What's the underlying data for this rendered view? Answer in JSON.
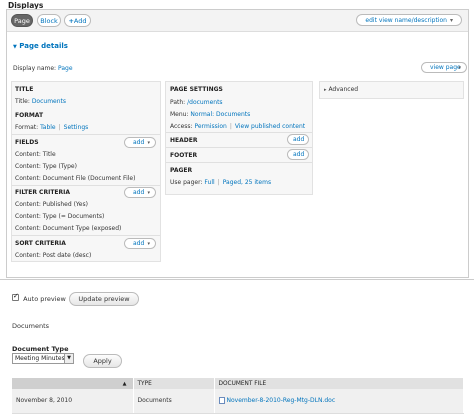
{
  "header": {
    "title": "Displays"
  },
  "tabs": [
    {
      "label": "Page",
      "active": true
    },
    {
      "label": "Block",
      "active": false
    },
    {
      "label": "Add",
      "active": false
    }
  ],
  "edit_view_label": "edit view name/description",
  "page_details": {
    "heading": "Page details",
    "display_name_label": "Display name:",
    "display_name_value": "Page",
    "view_page_label": "view page"
  },
  "left_col": {
    "title_head": "Title",
    "title_label": "Title:",
    "title_value": "Documents",
    "format_head": "Format",
    "format_label": "Format:",
    "format_value": "Table",
    "format_settings": "Settings",
    "fields_head": "Fields",
    "fields": [
      "Content: Title",
      "Content: Type (Type)",
      "Content: Document File (Document File)"
    ],
    "filter_head": "Filter criteria",
    "filters": [
      "Content: Published (Yes)",
      "Content: Type (= Documents)",
      "Content: Document Type (exposed)"
    ],
    "sort_head": "Sort criteria",
    "sorts": [
      "Content: Post date (desc)"
    ],
    "add_label": "add"
  },
  "middle_col": {
    "page_settings_head": "Page settings",
    "path_label": "Path:",
    "path_value": "/documents",
    "menu_label": "Menu:",
    "menu_value": "Normal: Documents",
    "access_label": "Access:",
    "access_value": "Permission",
    "access_extra": "View published content",
    "header_head": "Header",
    "footer_head": "Footer",
    "pager_head": "Pager",
    "pager_label": "Use pager:",
    "pager_value": "Full",
    "pager_extra": "Paged, 25 items",
    "add_label": "add"
  },
  "right_col": {
    "advanced_label": "Advanced"
  },
  "preview": {
    "auto_preview_label": "Auto preview",
    "auto_preview_checked": true,
    "update_button": "Update preview",
    "view_title": "Documents",
    "doc_type_label": "Document Type",
    "doc_type_selected": "Meeting Minutes",
    "apply_button": "Apply",
    "table": {
      "headers": [
        "",
        "TYPE",
        "DOCUMENT FILE"
      ],
      "rows": [
        {
          "date": "November 8, 2010",
          "type": "Documents",
          "file": "November-8-2010-Reg-Mtg-DLN.doc"
        }
      ]
    }
  }
}
